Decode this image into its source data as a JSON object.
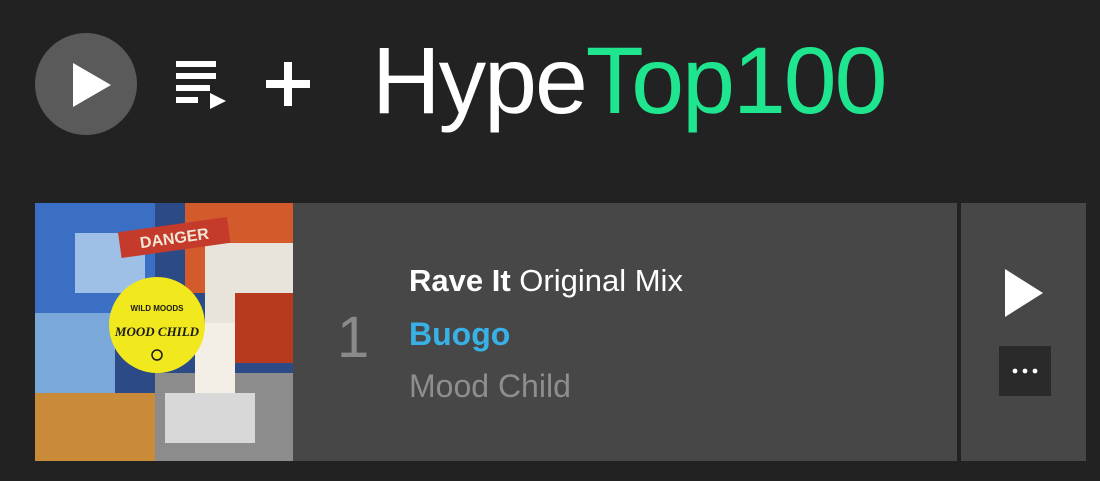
{
  "header": {
    "title_part1": "Hype",
    "title_part2": "Top100",
    "accent_color": "#1fe58e",
    "play_all_icon": "play-icon",
    "queue_icon": "add-to-queue-icon",
    "add_icon": "plus-icon"
  },
  "tracks": [
    {
      "rank": "1",
      "title": "Rave It",
      "mix": "Original Mix",
      "artist": "Buogo",
      "label": "Mood Child",
      "artwork_label_top": "WILD MOODS",
      "artwork_label_main": "MOOD CHILD",
      "artwork_sign": "DANGER",
      "artist_color": "#38b2e6",
      "play_icon": "play-icon",
      "more_icon": "more-options-icon"
    }
  ]
}
